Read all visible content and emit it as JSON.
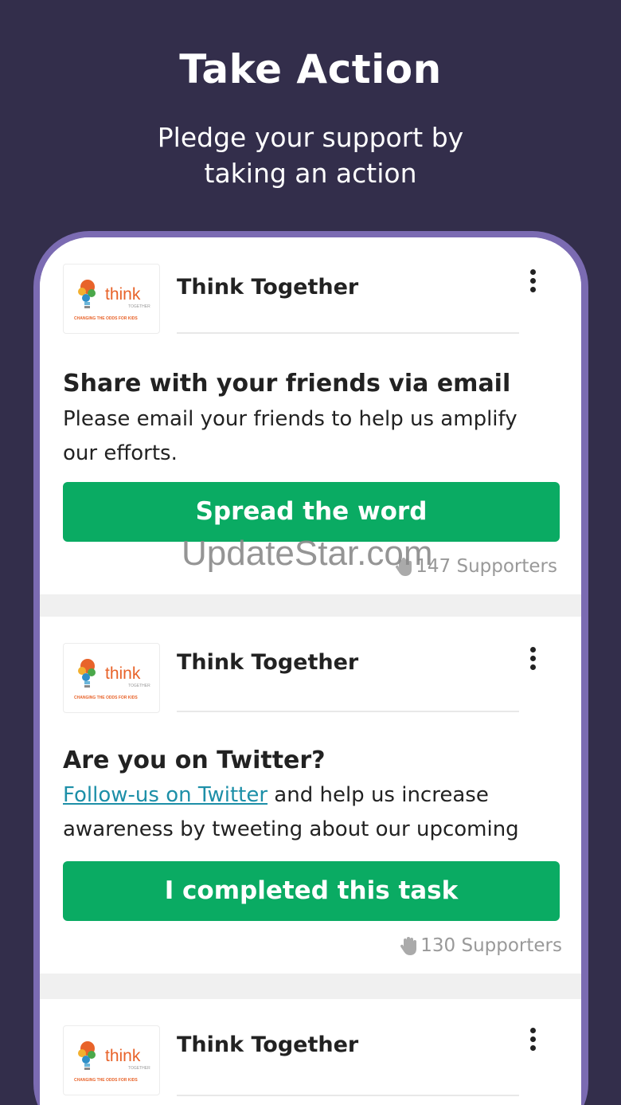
{
  "header": {
    "title": "Take Action",
    "subtitle": "Pledge your support by taking an action"
  },
  "cards": [
    {
      "org": "Think Together",
      "logo": {
        "word": "think",
        "sub": "TOGETHER",
        "tagline": "CHANGING THE ODDS FOR KIDS"
      },
      "title": "Share with your friends via email",
      "desc": "Please email your friends to help us amplify our efforts.",
      "button": "Spread the word",
      "supporters": "147 Supporters"
    },
    {
      "org": "Think Together",
      "logo": {
        "word": "think",
        "sub": "TOGETHER",
        "tagline": "CHANGING THE ODDS FOR KIDS"
      },
      "title": "Are you on Twitter?",
      "desc_link": "Follow-us on Twitter",
      "desc_rest": " and help us increase awareness by tweeting about our upcoming",
      "button": "I completed this task",
      "supporters": "130 Supporters"
    },
    {
      "org": "Think Together",
      "logo": {
        "word": "think",
        "sub": "TOGETHER",
        "tagline": "CHANGING THE ODDS FOR KIDS"
      }
    }
  ],
  "watermark": "UpdateStar.com",
  "colors": {
    "background": "#332e4b",
    "phone_frame": "#7b6bb2",
    "button": "#0aab63",
    "link": "#1d8fa8",
    "logo_orange": "#e8632a"
  },
  "icons": {
    "menu": "kebab-menu-icon",
    "supporters": "raised-hand-icon"
  }
}
